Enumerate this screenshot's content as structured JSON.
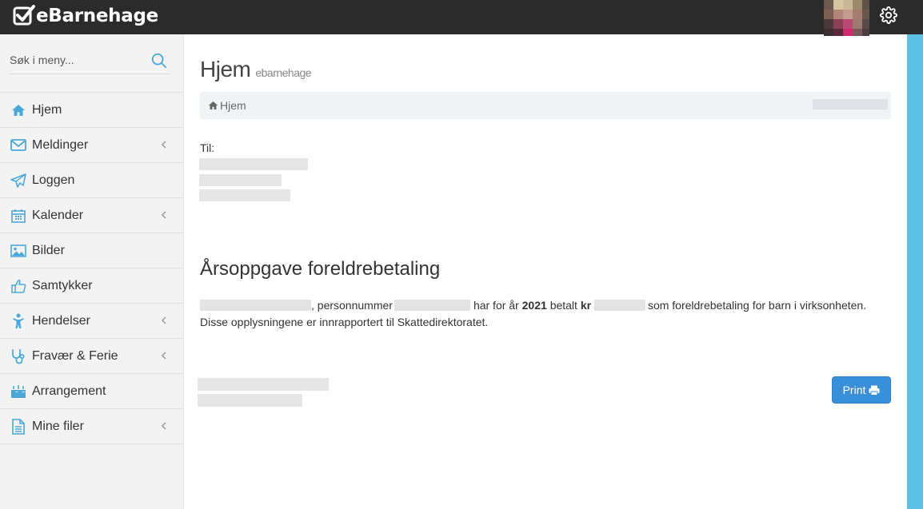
{
  "header": {
    "brand": "eBarnehage",
    "settings_icon": "gear-icon"
  },
  "sidebar": {
    "search_placeholder": "Søk i meny...",
    "items": [
      {
        "label": "Hjem",
        "icon": "home-icon",
        "has_submenu": false
      },
      {
        "label": "Meldinger",
        "icon": "envelope-icon",
        "has_submenu": true
      },
      {
        "label": "Loggen",
        "icon": "paper-plane-icon",
        "has_submenu": false
      },
      {
        "label": "Kalender",
        "icon": "calendar-icon",
        "has_submenu": true
      },
      {
        "label": "Bilder",
        "icon": "image-icon",
        "has_submenu": false
      },
      {
        "label": "Samtykker",
        "icon": "thumbs-up-icon",
        "has_submenu": false
      },
      {
        "label": "Hendelser",
        "icon": "child-icon",
        "has_submenu": true
      },
      {
        "label": "Fravær & Ferie",
        "icon": "stethoscope-icon",
        "has_submenu": true
      },
      {
        "label": "Arrangement",
        "icon": "birthday-cake-icon",
        "has_submenu": false
      },
      {
        "label": "Mine filer",
        "icon": "file-icon",
        "has_submenu": true
      }
    ]
  },
  "main": {
    "title": "Hjem",
    "subtitle": "ebarnehage",
    "breadcrumb": "Hjem",
    "to_label": "Til:",
    "section_title": "Årsoppgave foreldrebetaling",
    "statement": {
      "part1": ", personnummer",
      "part2": "har for år",
      "year": "2021",
      "part3": "betalt",
      "currency": "kr",
      "part4": "som foreldrebetaling for barn i virksonheten. Disse opplysningene er innrapportert til Skattedirektoratet."
    },
    "print_label": "Print"
  },
  "colors": {
    "topbar": "#2b2b2b",
    "accent": "#5bc0e4",
    "icon_blue": "#4aa8d8",
    "primary_button": "#3a8fd9"
  }
}
